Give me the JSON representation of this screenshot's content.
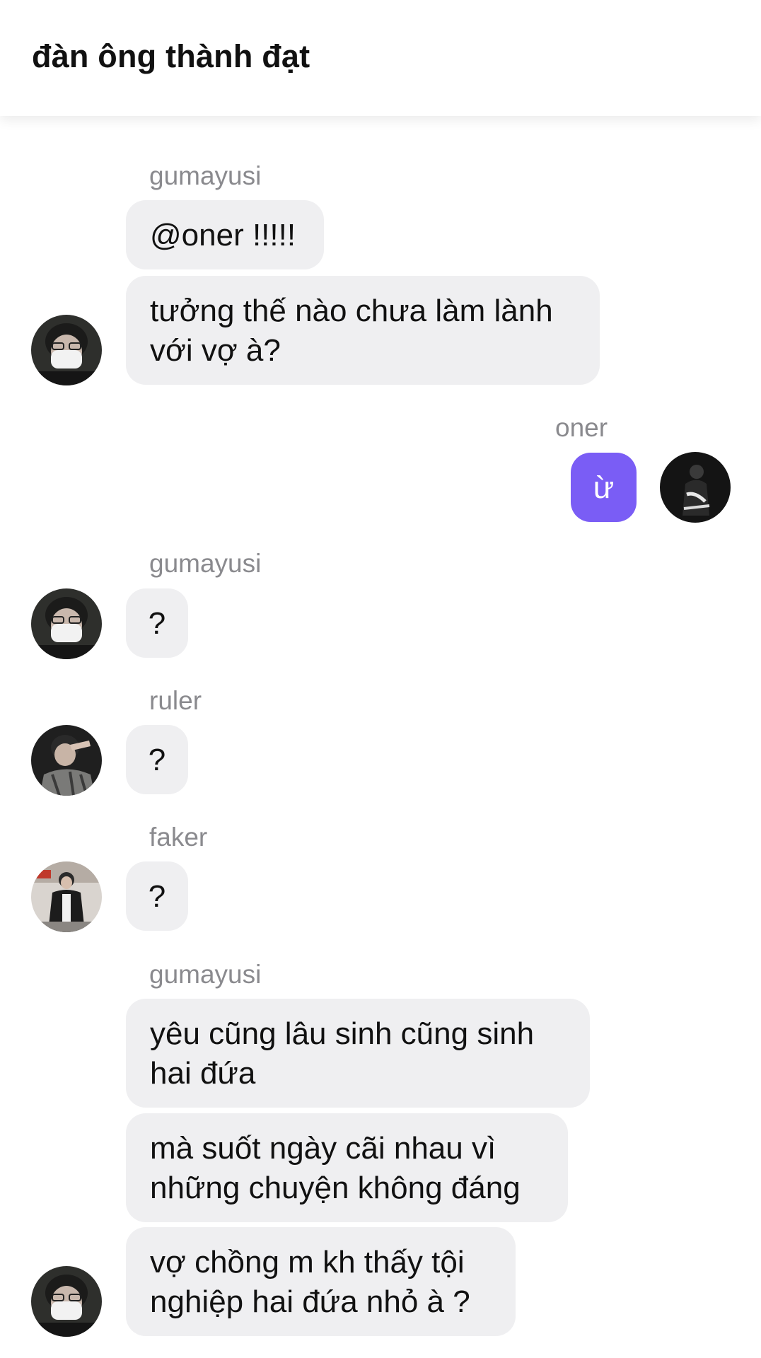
{
  "header": {
    "title": "đàn ông thành đạt"
  },
  "messages": [
    {
      "sender": "gumayusi",
      "bubbles": [
        "@oner !!!!!",
        "tưởng thế nào chưa làm lành\nvới vợ à?"
      ]
    },
    {
      "sender": "oner",
      "bubbles": [
        "ừ"
      ]
    },
    {
      "sender": "gumayusi",
      "bubbles": [
        "?"
      ]
    },
    {
      "sender": "ruler",
      "bubbles": [
        "?"
      ]
    },
    {
      "sender": "faker",
      "bubbles": [
        "?"
      ]
    },
    {
      "sender": "gumayusi",
      "bubbles": [
        "yêu cũng lâu sinh cũng sinh\nhai đứa",
        "mà suốt ngày cãi nhau vì\nnhững chuyện không đáng",
        "vợ chồng m kh thấy tội\nnghiệp hai đứa nhỏ à ?"
      ]
    }
  ],
  "colors": {
    "outgoing_bubble": "#7a5df5",
    "incoming_bubble": "#efeff1",
    "sender_text": "#8a8a8e"
  }
}
